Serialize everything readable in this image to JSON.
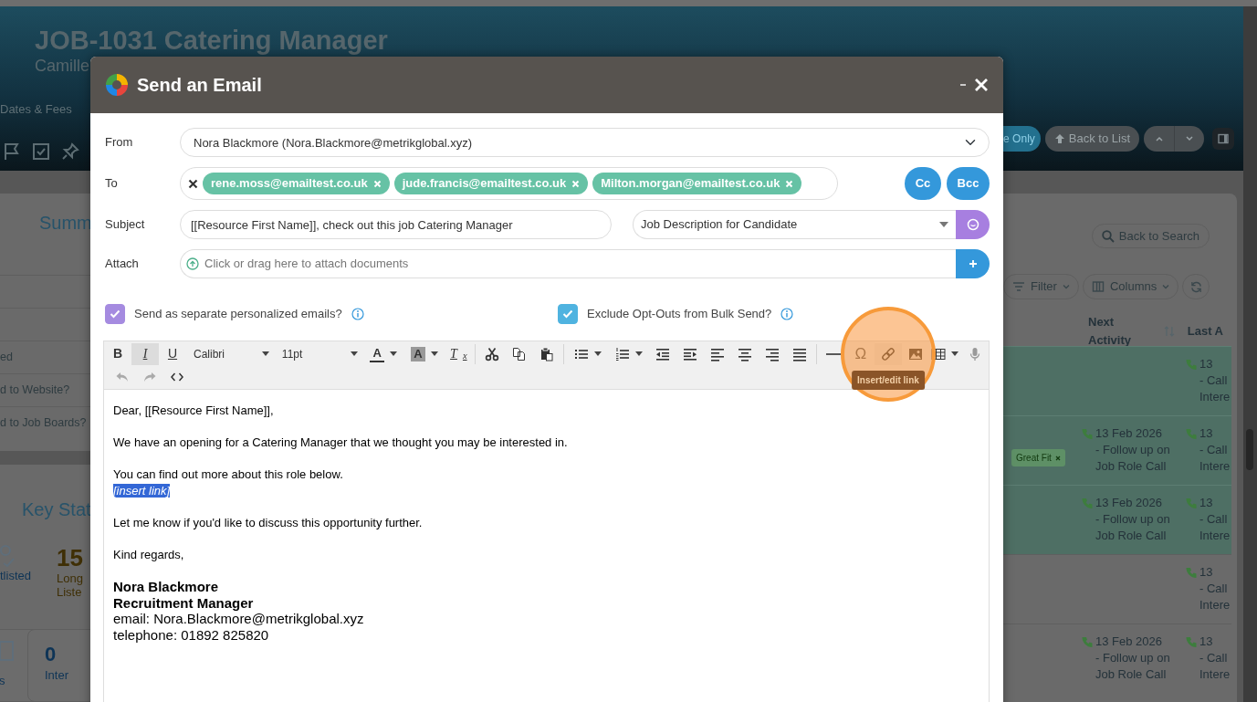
{
  "page": {
    "header": {
      "title": "JOB-1031 Catering Manager",
      "subtitle": "Camille",
      "tab": "Dates & Fees",
      "actions": [
        {
          "kind": "primary",
          "label": "e Only"
        },
        {
          "kind": "back",
          "label": "Back to List"
        }
      ]
    },
    "summary": {
      "heading": "Summ",
      "rows": [
        "ed",
        "d to Website?",
        "d to Job Boards?"
      ]
    },
    "key_stats": {
      "heading": "Key Stat",
      "stats": [
        {
          "kind": "icon",
          "label": "tlisted"
        },
        {
          "kind": "number",
          "value": "15",
          "label": "Long\nListe"
        }
      ],
      "tiles": [
        {
          "kind": "icon",
          "label": "s"
        },
        {
          "kind": "number",
          "value": "0",
          "label": "Inter"
        }
      ]
    },
    "results": {
      "search_button": "Back to Search",
      "tools": [
        "Filter",
        "Columns"
      ],
      "columns": [
        "Next Activity",
        "Last A"
      ],
      "rows": [
        {
          "highlighted": true,
          "last": "13\n- Call\nIntere"
        },
        {
          "highlighted": true,
          "tag": "Great Fit",
          "next": "13 Feb 2026\n- Follow up on\nJob Role Call",
          "last": "13\n- Call\nIntere"
        },
        {
          "highlighted": true,
          "next": "13 Feb 2026\n- Follow up on\nJob Role Call",
          "last": "13\n- Call\nIntere"
        },
        {
          "highlighted": false,
          "last": "13\n- Call\nIntere"
        },
        {
          "highlighted": false,
          "next": "13 Feb 2026\n- Follow up on\nJob Role Call",
          "last": "13\n- Call\nIntere"
        }
      ]
    }
  },
  "modal": {
    "title": "Send an Email",
    "from": {
      "label": "From",
      "value": "Nora Blackmore (Nora.Blackmore@metrikglobal.xyz)"
    },
    "to": {
      "label": "To",
      "recipients": [
        "rene.moss@emailtest.co.uk",
        "jude.francis@emailtest.co.uk",
        "Milton.morgan@emailtest.co.uk"
      ],
      "buttons": [
        "Cc",
        "Bcc"
      ]
    },
    "subject": {
      "label": "Subject",
      "value": "[[Resource First Name]], check out this job Catering Manager",
      "template": "Job Description for Candidate"
    },
    "attach": {
      "label": "Attach",
      "placeholder": "Click or drag here to attach documents"
    },
    "options": [
      {
        "label": "Send as separate personalized emails?",
        "checked": true,
        "color": "#a58be0"
      },
      {
        "label": "Exclude Opt-Outs from Bulk Send?",
        "checked": true,
        "color": "#4fb3e0"
      }
    ],
    "toolbar": [
      [
        {
          "kind": "glyph",
          "text": "B",
          "active": false
        },
        {
          "kind": "glyph",
          "text": "I",
          "active": true
        },
        {
          "kind": "glyph",
          "text": "U",
          "active": false
        },
        {
          "kind": "select",
          "text": "Calibri"
        },
        {
          "kind": "select",
          "text": "11pt"
        },
        {
          "kind": "color",
          "text": "A"
        },
        {
          "kind": "color",
          "text": "A"
        },
        {
          "kind": "glyph",
          "text": "T$_{x}$",
          "active": false
        },
        {
          "kind": "separator"
        },
        {
          "kind": "button"
        },
        {
          "kind": "button"
        },
        {
          "kind": "button"
        },
        {
          "kind": "separator"
        },
        {
          "kind": "button",
          "menu": true
        },
        {
          "kind": "button",
          "menu": true
        },
        {
          "kind": "button"
        },
        {
          "kind": "button"
        },
        {
          "kind": "button"
        },
        {
          "kind": "button"
        },
        {
          "kind": "button"
        },
        {
          "kind": "button"
        },
        {
          "kind": "separator"
        },
        {
          "kind": "button"
        },
        {
          "kind": "glyph",
          "text": "Ω",
          "active": false
        },
        {
          "kind": "button",
          "tooltip": "Insert/edit link"
        },
        {
          "kind": "button"
        },
        {
          "kind": "button",
          "menu": true
        },
        {
          "kind": "button"
        }
      ],
      [
        {
          "kind": "button",
          "disabled": true
        },
        {
          "kind": "button",
          "disabled": true
        },
        {
          "kind": "button",
          "disabled": false
        }
      ]
    ],
    "body": [
      {
        "lines": [
          {
            "text": "Dear, [[Resource First Name]],",
            "selected": false
          }
        ]
      },
      {
        "lines": [
          {
            "text": "We have an opening for a Catering Manager that we thought you may be interested in.",
            "selected": false
          }
        ]
      },
      {
        "lines": [
          {
            "text": "You can find out more about this role below.",
            "selected": false
          },
          {
            "text": "[insert link]",
            "selected": true
          }
        ]
      },
      {
        "lines": [
          {
            "text": "Let me know if you'd like to discuss this opportunity further.",
            "selected": false
          }
        ]
      },
      {
        "lines": [
          {
            "text": "Kind regards,",
            "selected": false
          }
        ]
      }
    ],
    "signature": {
      "name": "Nora Blackmore",
      "role": "Recruitment Manager",
      "lines": [
        "email: Nora.Blackmore@metrikglobal.xyz",
        "telephone: 01892 825820"
      ]
    }
  }
}
